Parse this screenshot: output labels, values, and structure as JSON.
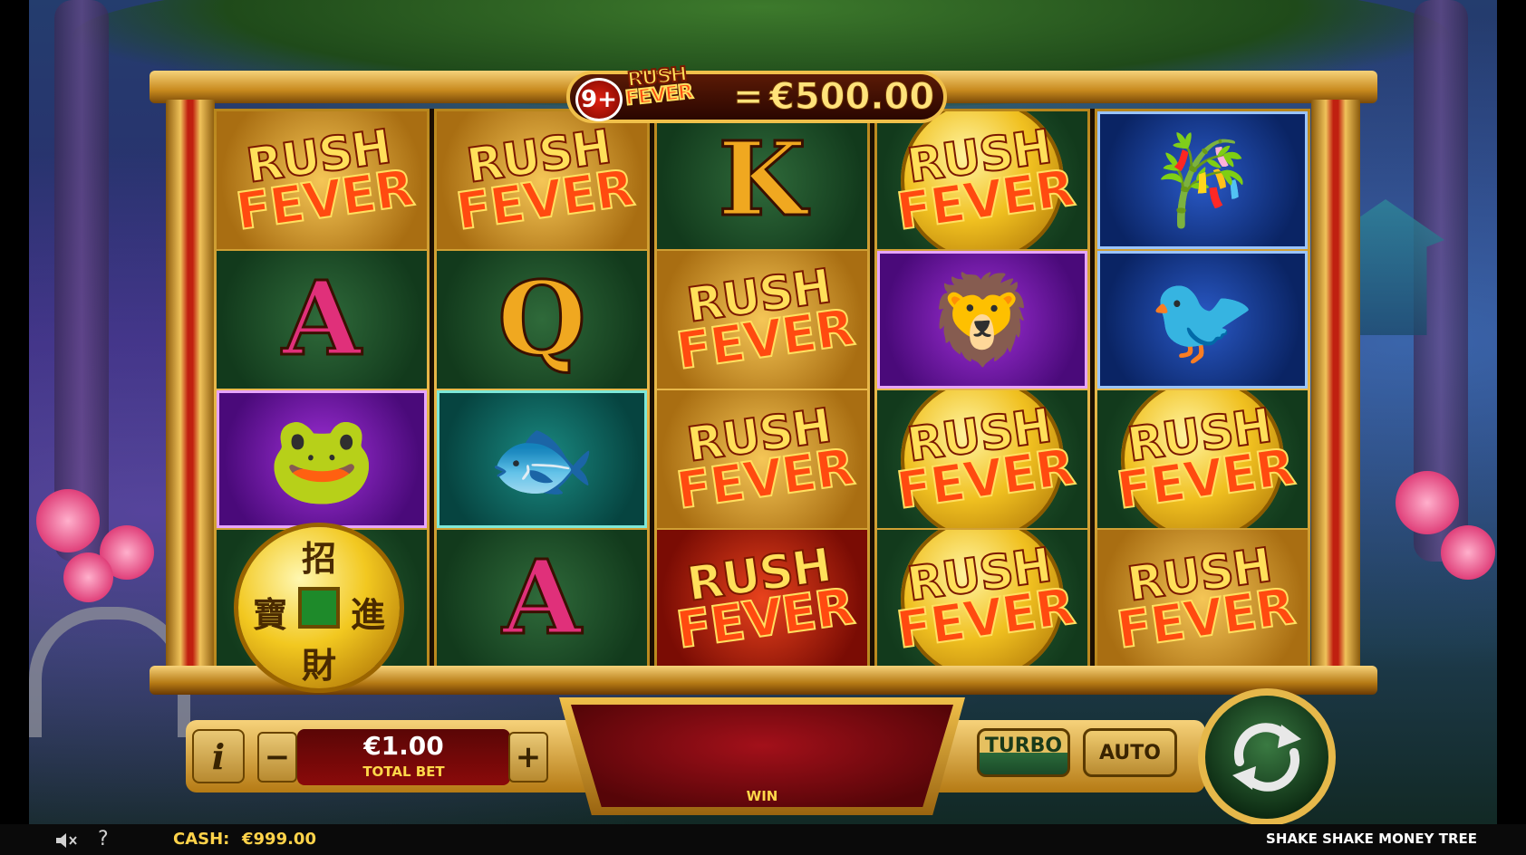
{
  "banner": {
    "count_badge": "9+",
    "logo_word1": "RUSH",
    "logo_word2": "FEVER",
    "equals": "=",
    "prize": "€500.00"
  },
  "reels": [
    {
      "cells": [
        {
          "symbol": "rush-fever",
          "bg": "gold",
          "word1": "RUSH",
          "word2": "FEVER"
        },
        {
          "symbol": "letter",
          "bg": "green",
          "text": "A",
          "color": "pink"
        },
        {
          "symbol": "golden-toad",
          "bg": "purple"
        },
        {
          "symbol": "money-coin",
          "bg": "green"
        }
      ]
    },
    {
      "cells": [
        {
          "symbol": "rush-fever",
          "bg": "gold",
          "word1": "RUSH",
          "word2": "FEVER"
        },
        {
          "symbol": "letter",
          "bg": "green",
          "text": "Q",
          "color": "gold"
        },
        {
          "symbol": "golden-koi",
          "bg": "teal"
        },
        {
          "symbol": "letter",
          "bg": "green",
          "text": "A",
          "color": "pink"
        }
      ]
    },
    {
      "cells": [
        {
          "symbol": "letter",
          "bg": "green",
          "text": "K",
          "color": "gold"
        },
        {
          "symbol": "rush-fever",
          "bg": "gold",
          "word1": "RUSH",
          "word2": "FEVER"
        },
        {
          "symbol": "rush-fever",
          "bg": "gold",
          "word1": "RUSH",
          "word2": "FEVER"
        },
        {
          "symbol": "rush-fever",
          "bg": "red",
          "word1": "RUSH",
          "word2": "FEVER"
        }
      ]
    },
    {
      "cells": [
        {
          "symbol": "rush-fever-coin",
          "bg": "green",
          "word1": "RUSH",
          "word2": "FEVER"
        },
        {
          "symbol": "golden-foo-dog",
          "bg": "purple"
        },
        {
          "symbol": "rush-fever-coin",
          "bg": "green",
          "word1": "RUSH",
          "word2": "FEVER"
        },
        {
          "symbol": "rush-fever-coin",
          "bg": "green",
          "word1": "RUSH",
          "word2": "FEVER"
        }
      ]
    },
    {
      "cells": [
        {
          "symbol": "bamboo-plant",
          "bg": "blue"
        },
        {
          "symbol": "golden-birds",
          "bg": "blue"
        },
        {
          "symbol": "rush-fever-coin",
          "bg": "green",
          "word1": "RUSH",
          "word2": "FEVER"
        },
        {
          "symbol": "rush-fever",
          "bg": "gold",
          "word1": "RUSH",
          "word2": "FEVER"
        }
      ]
    }
  ],
  "coin_chars": {
    "top": "招",
    "left": "寶",
    "right": "進",
    "bottom": "財"
  },
  "controls": {
    "info_label": "i",
    "minus_label": "−",
    "plus_label": "+",
    "bet_value": "€1.00",
    "bet_label": "TOTAL BET",
    "win_label": "WIN",
    "turbo_label": "TURBO",
    "auto_label": "AUTO"
  },
  "status_bar": {
    "help_label": "?",
    "cash_label": "CASH:",
    "cash_value": "€999.00",
    "game_title": "SHAKE SHAKE MONEY TREE"
  }
}
